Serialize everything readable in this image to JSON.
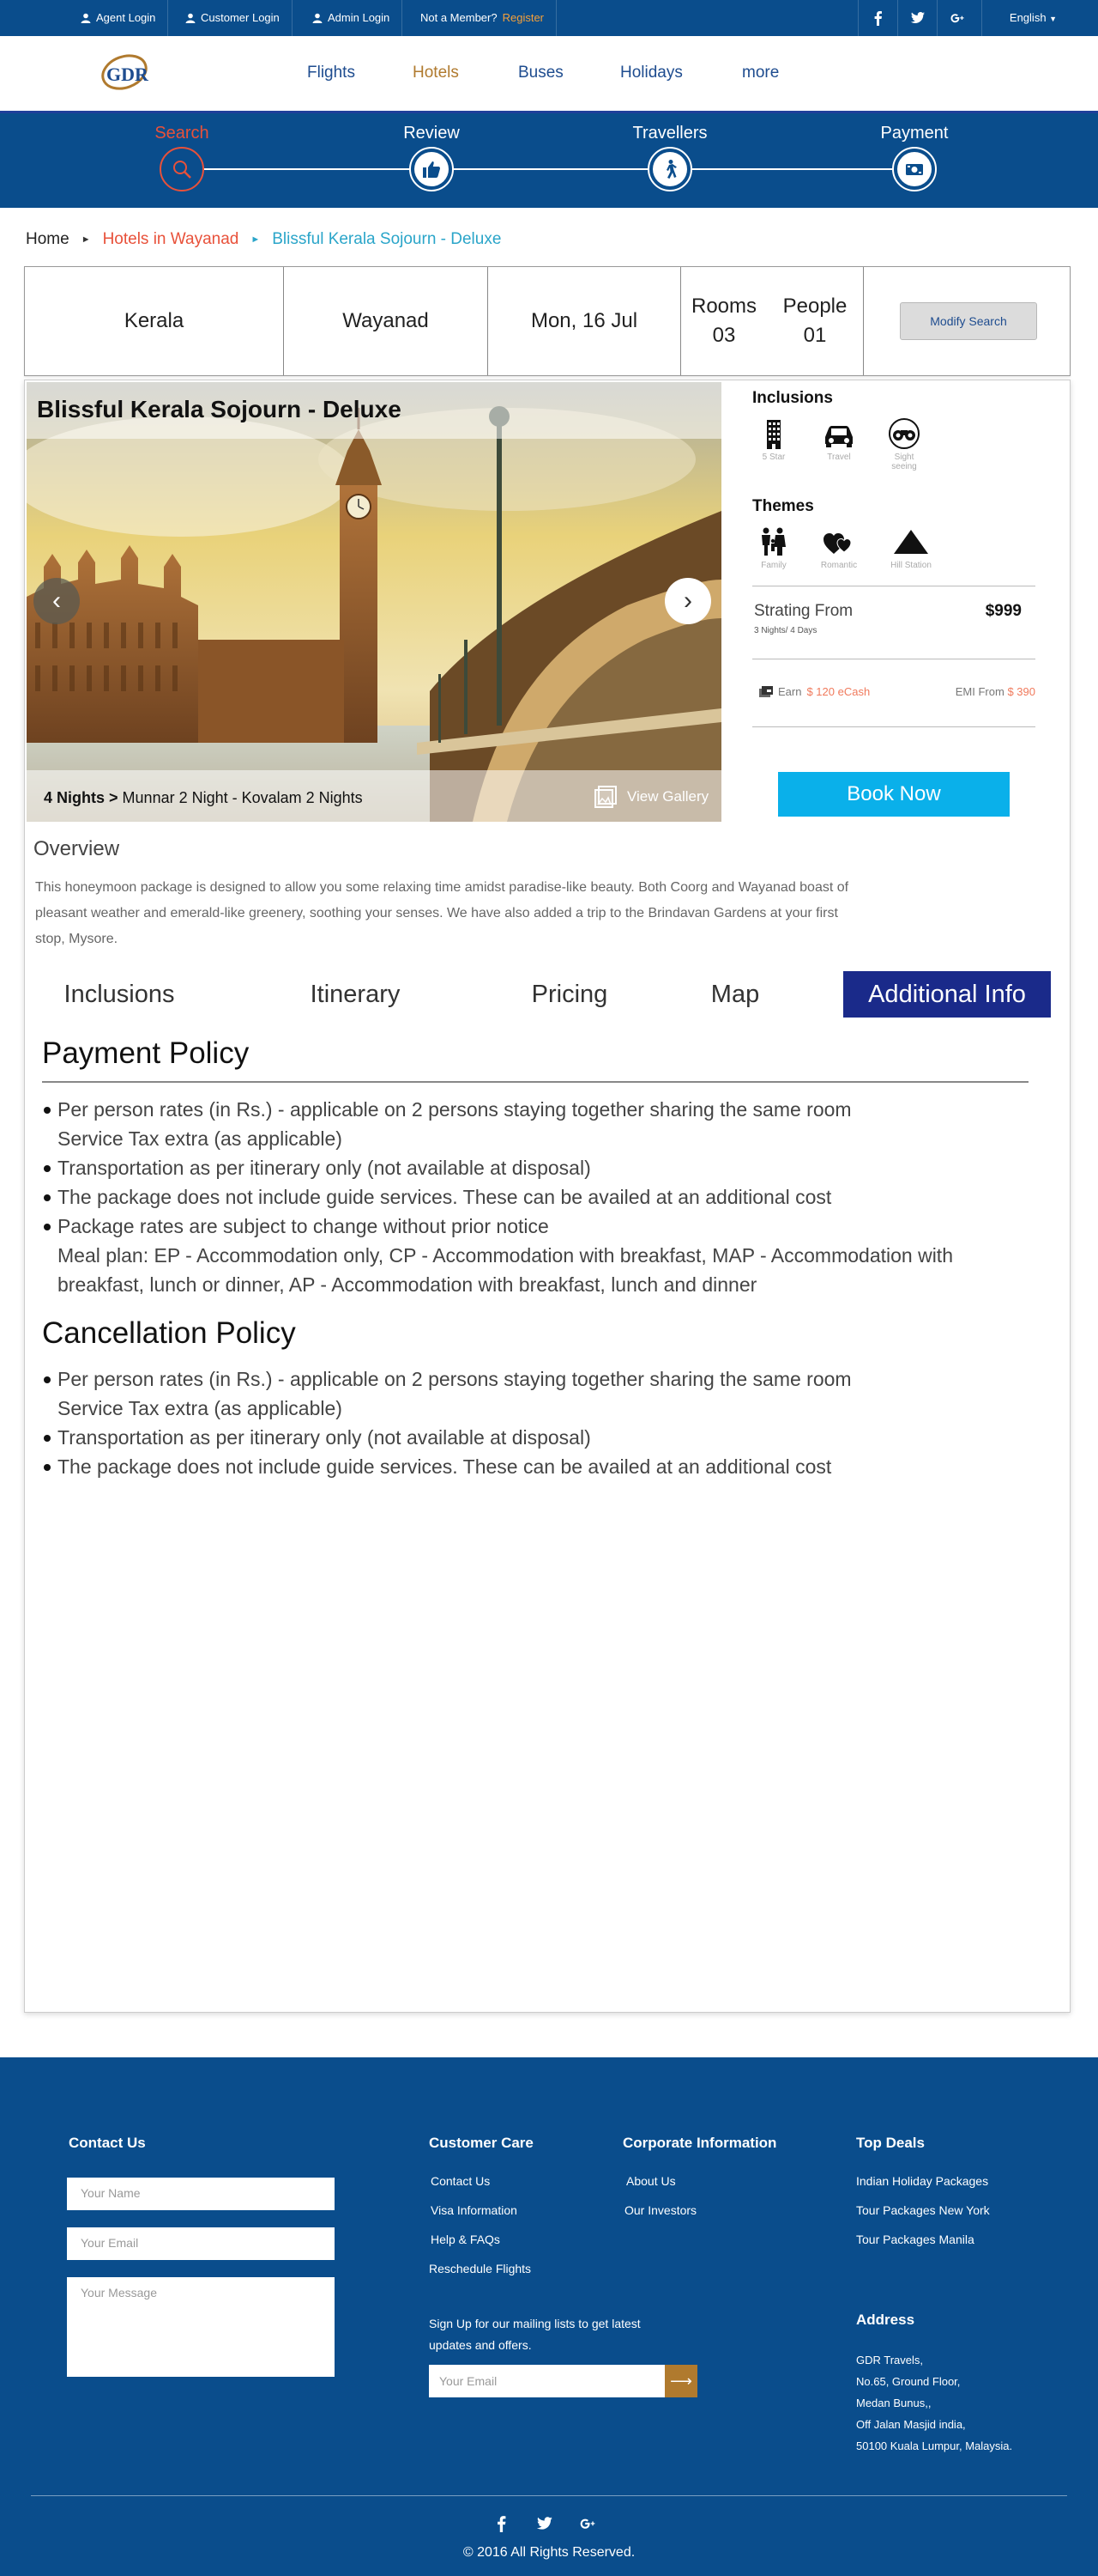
{
  "topbar": {
    "agent_login": "Agent Login",
    "customer_login": "Customer Login",
    "admin_login": "Admin Login",
    "not_member": "Not a Member?",
    "register": "Register",
    "language": "English"
  },
  "nav": {
    "logo_text": "GDR",
    "links": [
      "Flights",
      "Hotels",
      "Buses",
      "Holidays",
      "more"
    ],
    "active": "Hotels"
  },
  "steps": [
    {
      "label": "Search",
      "icon": "search-icon",
      "active": true
    },
    {
      "label": "Review",
      "icon": "thumbs-up-icon",
      "active": false
    },
    {
      "label": "Travellers",
      "icon": "walking-person-icon",
      "active": false
    },
    {
      "label": "Payment",
      "icon": "cash-icon",
      "active": false
    }
  ],
  "breadcrumb": {
    "home": "Home",
    "level2": "Hotels in Wayanad",
    "level3": "Blissful Kerala Sojourn - Deluxe"
  },
  "search_summary": {
    "state": "Kerala",
    "city": "Wayanad",
    "date": "Mon, 16 Jul",
    "rooms_label": "Rooms",
    "rooms_value": "03",
    "people_label": "People",
    "people_value": "01",
    "modify_button": "Modify Search"
  },
  "package": {
    "title": "Blissful Kerala Sojourn - Deluxe",
    "nights_bold": "4 Nights >",
    "nights_detail": "Munnar 2 Night - Kovalam 2 Nights",
    "view_gallery": "View Gallery"
  },
  "inclusions": {
    "heading": "Inclusions",
    "items": [
      {
        "label": "5 Star",
        "icon": "building-icon"
      },
      {
        "label": "Travel",
        "icon": "car-icon"
      },
      {
        "label": "Sight seeing",
        "icon": "binoculars-icon"
      }
    ]
  },
  "themes": {
    "heading": "Themes",
    "items": [
      {
        "label": "Family",
        "icon": "family-icon"
      },
      {
        "label": "Romantic",
        "icon": "hearts-icon"
      },
      {
        "label": "Hill Station",
        "icon": "mountain-icon"
      }
    ]
  },
  "pricing": {
    "starting_label": "Strating From",
    "duration": "3 Nights/ 4 Days",
    "price": "$999",
    "earn_label": "Earn",
    "earn_value": "$ 120 eCash",
    "emi_label": "EMI From",
    "emi_value": "$ 390",
    "book_button": "Book Now"
  },
  "overview": {
    "heading": "Overview",
    "text": "This honeymoon package is designed to allow you some relaxing time amidst paradise-like beauty. Both Coorg and Wayanad boast of pleasant weather and emerald-like greenery, soothing your senses. We have also added a trip to the Brindavan Gardens at your first stop, Mysore."
  },
  "tabs": [
    "Inclusions",
    "Itinerary",
    "Pricing",
    "Map",
    "Additional Info"
  ],
  "active_tab": "Additional Info",
  "payment_policy": {
    "heading": "Payment Policy",
    "items": [
      {
        "text": "Per person rates (in Rs.) - applicable on 2 persons staying together sharing the same room",
        "bullet": true
      },
      {
        "text": "Service Tax extra (as applicable)",
        "bullet": false
      },
      {
        "text": "Transportation as per itinerary only (not available at disposal)",
        "bullet": true
      },
      {
        "text": "The package does not include guide services. These can be availed at an additional cost",
        "bullet": true
      },
      {
        "text": "Package rates are subject to change without prior notice",
        "bullet": true
      },
      {
        "text": "Meal plan: EP - Accommodation only, CP - Accommodation with breakfast, MAP - Accommodation with breakfast, lunch or dinner, AP - Accommodation with breakfast, lunch and dinner",
        "bullet": false
      }
    ]
  },
  "cancellation_policy": {
    "heading": "Cancellation Policy",
    "items": [
      {
        "text": "Per person rates (in Rs.) - applicable on 2 persons staying together sharing the same room",
        "bullet": true
      },
      {
        "text": "Service Tax extra (as applicable)",
        "bullet": false
      },
      {
        "text": "Transportation as per itinerary only (not available at disposal)",
        "bullet": true
      },
      {
        "text": "The package does not include guide services. These can be availed at an additional cost",
        "bullet": true
      }
    ]
  },
  "footer": {
    "contact_heading": "Contact Us",
    "name_placeholder": "Your Name",
    "email_placeholder": "Your Email",
    "message_placeholder": "Your Message",
    "customer_care_heading": "Customer Care",
    "customer_care_links": [
      "Contact Us",
      "Visa Information",
      "Help & FAQs",
      "Reschedule Flights"
    ],
    "corporate_heading": "Corporate Information",
    "corporate_links": [
      "About Us",
      "Our Investors"
    ],
    "top_deals_heading": "Top Deals",
    "top_deals_links": [
      "Indian Holiday Packages",
      "Tour Packages New York",
      "Tour Packages Manila"
    ],
    "signup_text_1": "Sign Up for our mailing lists to get latest",
    "signup_text_2": "updates and offers.",
    "signup_placeholder": "Your Email",
    "address_heading": "Address",
    "address_lines": [
      "GDR Travels,",
      "No.65, Ground Floor,",
      "Medan Bunus,,",
      "Off Jalan Masjid india,",
      "50100 Kuala Lumpur, Malaysia."
    ],
    "copyright": "© 2016 All Rights Reserved."
  },
  "colors": {
    "brand_blue": "#0a4d8c",
    "accent_orange": "#e8513a",
    "tab_active": "#1a2a8a",
    "book_button": "#0ab0ea",
    "gold": "#b07a2e"
  }
}
